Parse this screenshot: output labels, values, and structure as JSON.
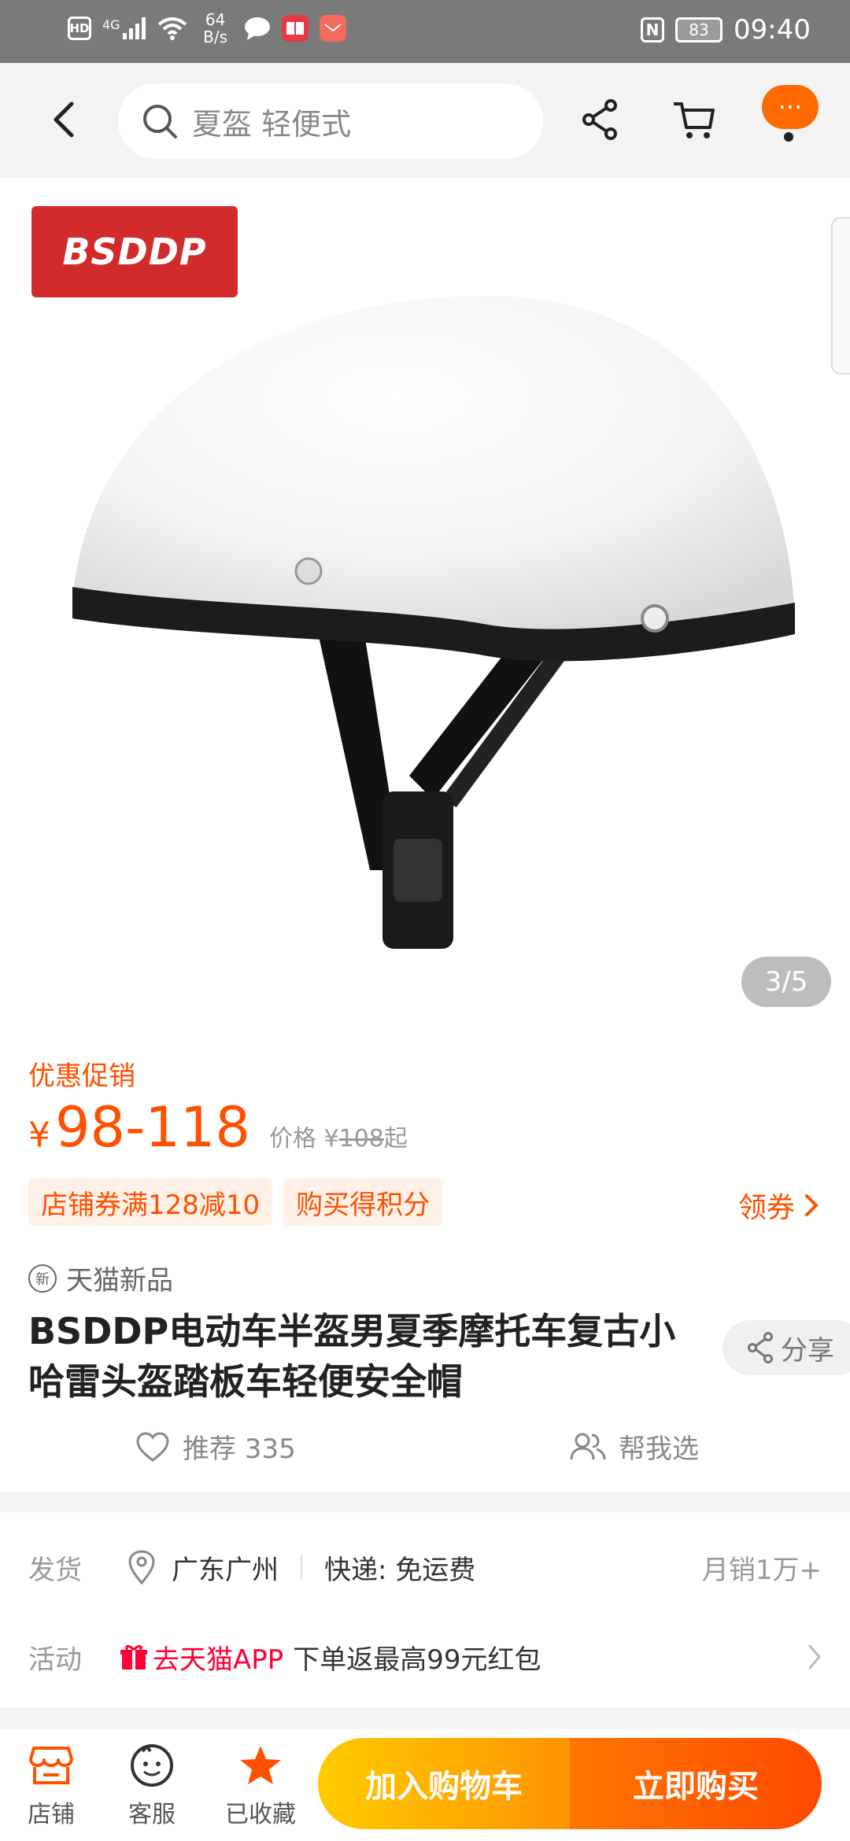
{
  "status_bar": {
    "hd": "HD",
    "signal": "4G",
    "net_speed_value": "64",
    "net_speed_unit": "B/s",
    "battery": "83",
    "nfc": "N",
    "time": "09:40"
  },
  "top_nav": {
    "search_text": "夏盔 轻便式",
    "more_label": "···"
  },
  "hero": {
    "brand_logo_text": "BSDDP",
    "page_indicator": "3/5"
  },
  "price": {
    "promo_label": "优惠促销",
    "yen": "¥",
    "range": "98-118",
    "orig_prefix": "价格 ¥",
    "orig_value": "108",
    "orig_suffix": "起"
  },
  "tags": [
    "店铺券满128减10",
    "购买得积分"
  ],
  "coupon_link": "领券",
  "product": {
    "new_badge": "新",
    "new_label": "天猫新品",
    "title": "BSDDP电动车半盔男夏季摩托车复古小哈雷头盔踏板车轻便安全帽",
    "share_label": "分享"
  },
  "actions": {
    "recommend": "推荐 335",
    "help_choose": "帮我选"
  },
  "shipping": {
    "label": "发货",
    "location": "广东广州",
    "express": "快递: 免运费",
    "monthly_sales": "月销1万+"
  },
  "activity": {
    "label": "活动",
    "link": "去天猫APP",
    "text": "下单返最高99元红包"
  },
  "bottom_bar": {
    "store": "店铺",
    "service": "客服",
    "favorited": "已收藏",
    "add_to_cart": "加入购物车",
    "buy_now": "立即购买"
  },
  "colors": {
    "accent": "#ff5000",
    "tmall_red": "#ff0036",
    "cart_button": "#ffa000",
    "buy_button": "#ff5a00"
  }
}
